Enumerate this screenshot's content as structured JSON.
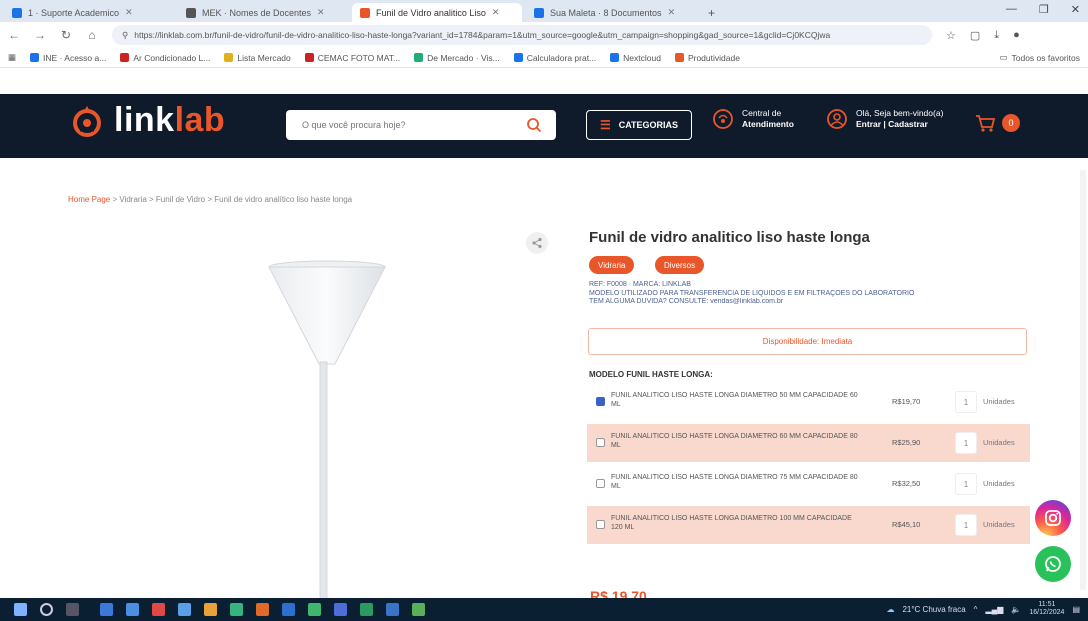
{
  "browser": {
    "tabs": [
      {
        "label": "1 · Suporte Academico",
        "color": "#1a73e8",
        "active": false
      },
      {
        "label": "MEK · Nomes de Docentes",
        "color": "#555555",
        "active": false
      },
      {
        "label": "Funil de Vidro analitico Liso",
        "color": "#e8562a",
        "active": true
      },
      {
        "label": "Sua Maleta · 8 Documentos",
        "color": "#1a73e8",
        "active": false
      }
    ],
    "new_tab": "+",
    "url": "https://linklab.com.br/funil-de-vidro/funil-de-vidro-analitico-liso-haste-longa?variant_id=1784&param=1&utm_source=google&utm_campaign=shopping&gad_source=1&gclid=Cj0KCQjwa",
    "bookmarks": [
      {
        "label": "INE · Acesso a...",
        "color": "#1a73e8"
      },
      {
        "label": "Ar Condicionado L...",
        "color": "#c22"
      },
      {
        "label": "Lista Mercado",
        "color": "#e0b020"
      },
      {
        "label": "CEMAC FOTO MAT...",
        "color": "#c22"
      },
      {
        "label": "De Mercado · Vis...",
        "color": "#2a7"
      },
      {
        "label": "Calculadora prat...",
        "color": "#1a73e8"
      },
      {
        "label": "Nextcloud",
        "color": "#1a73e8"
      },
      {
        "label": "Produtividade",
        "color": "#e8562a"
      }
    ],
    "bookmarks_right": "Todos os favoritos"
  },
  "header": {
    "logo_a": "link",
    "logo_b": "lab",
    "search_placeholder": "O que você procura hoje?",
    "categories_label": "CATEGORIAS",
    "atendimento_line1": "Central de",
    "atendimento_line2": "Atendimento",
    "account_line1": "Olá, Seja bem-vindo(a)",
    "account_line2": "Entrar | Cadastrar",
    "cart_count": "0"
  },
  "breadcrumb": {
    "home": "Home Page",
    "path": " > Vidraria > Funil de Vidro > Funil de vidro analítico liso haste longa"
  },
  "product": {
    "title": "Funil de vidro analitico liso haste longa",
    "tags": [
      "Vidraria",
      "Diversos"
    ],
    "info": [
      "REF: F0008 · MARCA: LINKLAB",
      "MODELO UTILIZADO PARA TRANSFERÊNCIA DE LÍQUIDOS E EM FILTRAÇÕES DO LABORATÓRIO",
      "TEM ALGUMA DÚVIDA? CONSULTE: vendas@linklab.com.br"
    ],
    "availability": "Disponibilidade: Imediata",
    "model_heading": "MODELO FUNIL HASTE LONGA:",
    "variants": [
      {
        "desc": "FUNIL ANALITICO LISO HASTE LONGA DIAMETRO 50 MM CAPACIDADE 60 ML",
        "price": "R$19,70",
        "qty": "1",
        "unit": "Unidades",
        "checked": true,
        "shaded": false
      },
      {
        "desc": "FUNIL ANALITICO LISO HASTE LONGA DIAMETRO 60 MM CAPACIDADE 80 ML",
        "price": "R$25,90",
        "qty": "1",
        "unit": "Unidades",
        "checked": false,
        "shaded": true
      },
      {
        "desc": "FUNIL ANALITICO LISO HASTE LONGA DIAMETRO 75 MM CAPACIDADE 80 ML",
        "price": "R$32,50",
        "qty": "1",
        "unit": "Unidades",
        "checked": false,
        "shaded": false
      },
      {
        "desc": "FUNIL ANALITICO LISO HASTE LONGA DIAMETRO 100 MM CAPACIDADE 120 ML",
        "price": "R$45,10",
        "qty": "1",
        "unit": "Unidades",
        "checked": false,
        "shaded": true
      }
    ],
    "price": "R$ 19,70"
  },
  "taskbar": {
    "weather": "21°C  Chuva fraca",
    "time": "11:51",
    "date": "16/12/2024"
  },
  "colors": {
    "brand": "#e8562a",
    "header_bg": "#0f1b2a"
  }
}
